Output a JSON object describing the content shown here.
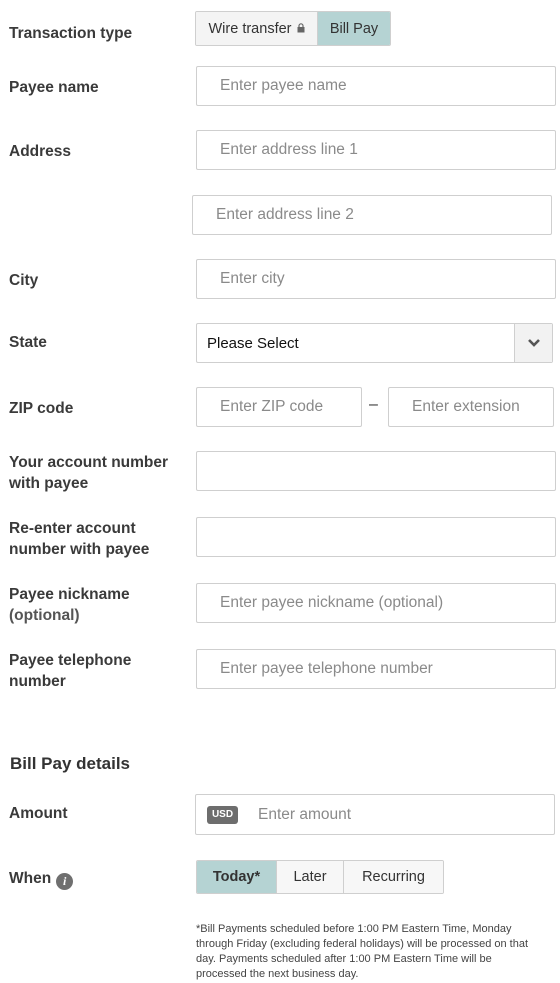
{
  "transaction": {
    "label": "Transaction type",
    "options": [
      "Wire transfer",
      "Bill Pay"
    ],
    "active": "Bill Pay"
  },
  "payee_name": {
    "label": "Payee name",
    "placeholder": "Enter payee name"
  },
  "address": {
    "label": "Address",
    "line1_placeholder": "Enter address line 1",
    "line2_placeholder": "Enter address line 2"
  },
  "city": {
    "label": "City",
    "placeholder": "Enter city"
  },
  "state": {
    "label": "State",
    "value": "Please Select"
  },
  "zip": {
    "label": "ZIP code",
    "placeholder": "Enter ZIP code",
    "separator": "–",
    "extension_placeholder": "Enter extension"
  },
  "account_number": {
    "label_line1": "Your account number",
    "label_line2": "with payee"
  },
  "reenter_account": {
    "label_line1": "Re-enter account",
    "label_line2": "number with payee"
  },
  "nickname": {
    "label_line1": "Payee nickname",
    "label_line2": "(optional)",
    "placeholder": "Enter payee nickname (optional)"
  },
  "telephone": {
    "label_line1": "Payee telephone",
    "label_line2": "number",
    "placeholder": "Enter payee telephone number"
  },
  "details": {
    "title": "Bill Pay details"
  },
  "amount": {
    "label": "Amount",
    "currency": "USD",
    "placeholder": "Enter amount"
  },
  "when": {
    "label": "When",
    "options": [
      "Today*",
      "Later",
      "Recurring"
    ],
    "active": "Today*"
  },
  "footnote": "*Bill Payments scheduled before 1:00 PM Eastern Time, Monday through Friday (excluding federal holidays) will be processed on that day. Payments scheduled after 1:00 PM Eastern Time will be processed the next business day."
}
